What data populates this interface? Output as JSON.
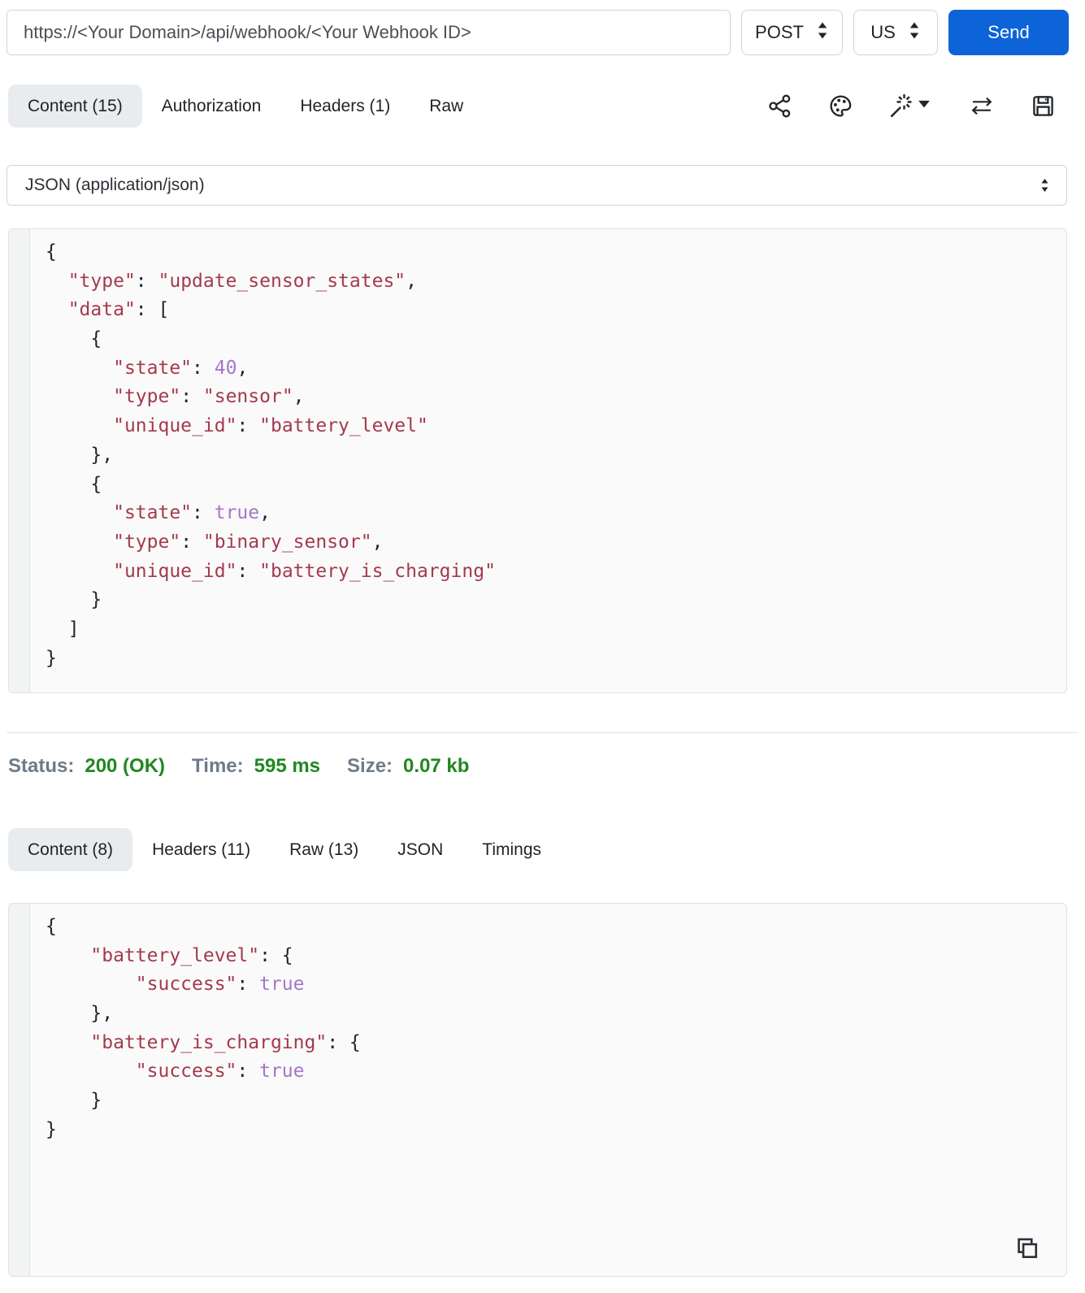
{
  "request_bar": {
    "url": "https://<Your Domain>/api/webhook/<Your Webhook ID>",
    "method": "POST",
    "region": "US",
    "send_label": "Send"
  },
  "request_tabs": {
    "items": [
      {
        "label": "Content (15)",
        "active": true
      },
      {
        "label": "Authorization",
        "active": false
      },
      {
        "label": "Headers (1)",
        "active": false
      },
      {
        "label": "Raw",
        "active": false
      }
    ]
  },
  "toolbar": {
    "icons": [
      "share-icon",
      "palette-icon",
      "magic-wand-icon",
      "caret-down-icon",
      "transfer-arrows-icon",
      "save-icon"
    ]
  },
  "content_type_select": {
    "selected": "JSON (application/json)"
  },
  "request_body": {
    "lines": [
      [
        {
          "t": "{",
          "c": "p"
        }
      ],
      [
        {
          "t": "  ",
          "c": "p"
        },
        {
          "t": "\"type\"",
          "c": "s"
        },
        {
          "t": ": ",
          "c": "p"
        },
        {
          "t": "\"update_sensor_states\"",
          "c": "s"
        },
        {
          "t": ",",
          "c": "p"
        }
      ],
      [
        {
          "t": "  ",
          "c": "p"
        },
        {
          "t": "\"data\"",
          "c": "s"
        },
        {
          "t": ": [",
          "c": "p"
        }
      ],
      [
        {
          "t": "    {",
          "c": "p"
        }
      ],
      [
        {
          "t": "      ",
          "c": "p"
        },
        {
          "t": "\"state\"",
          "c": "s"
        },
        {
          "t": ": ",
          "c": "p"
        },
        {
          "t": "40",
          "c": "n"
        },
        {
          "t": ",",
          "c": "p"
        }
      ],
      [
        {
          "t": "      ",
          "c": "p"
        },
        {
          "t": "\"type\"",
          "c": "s"
        },
        {
          "t": ": ",
          "c": "p"
        },
        {
          "t": "\"sensor\"",
          "c": "s"
        },
        {
          "t": ",",
          "c": "p"
        }
      ],
      [
        {
          "t": "      ",
          "c": "p"
        },
        {
          "t": "\"unique_id\"",
          "c": "s"
        },
        {
          "t": ": ",
          "c": "p"
        },
        {
          "t": "\"battery_level\"",
          "c": "s"
        }
      ],
      [
        {
          "t": "    },",
          "c": "p"
        }
      ],
      [
        {
          "t": "    {",
          "c": "p"
        }
      ],
      [
        {
          "t": "      ",
          "c": "p"
        },
        {
          "t": "\"state\"",
          "c": "s"
        },
        {
          "t": ": ",
          "c": "p"
        },
        {
          "t": "true",
          "c": "n"
        },
        {
          "t": ",",
          "c": "p"
        }
      ],
      [
        {
          "t": "      ",
          "c": "p"
        },
        {
          "t": "\"type\"",
          "c": "s"
        },
        {
          "t": ": ",
          "c": "p"
        },
        {
          "t": "\"binary_sensor\"",
          "c": "s"
        },
        {
          "t": ",",
          "c": "p"
        }
      ],
      [
        {
          "t": "      ",
          "c": "p"
        },
        {
          "t": "\"unique_id\"",
          "c": "s"
        },
        {
          "t": ": ",
          "c": "p"
        },
        {
          "t": "\"battery_is_charging\"",
          "c": "s"
        }
      ],
      [
        {
          "t": "    }",
          "c": "p"
        }
      ],
      [
        {
          "t": "  ]",
          "c": "p"
        }
      ],
      [
        {
          "t": "}",
          "c": "p"
        }
      ]
    ]
  },
  "response_summary": {
    "items": [
      {
        "label": "Status:",
        "value": "200 (OK)"
      },
      {
        "label": "Time:",
        "value": "595 ms"
      },
      {
        "label": "Size:",
        "value": "0.07 kb"
      }
    ]
  },
  "response_tabs": {
    "items": [
      {
        "label": "Content (8)",
        "active": true
      },
      {
        "label": "Headers (11)",
        "active": false
      },
      {
        "label": "Raw (13)",
        "active": false
      },
      {
        "label": "JSON",
        "active": false
      },
      {
        "label": "Timings",
        "active": false
      }
    ]
  },
  "response_body": {
    "lines": [
      [
        {
          "t": "{",
          "c": "p"
        }
      ],
      [
        {
          "t": "    ",
          "c": "p"
        },
        {
          "t": "\"battery_level\"",
          "c": "s"
        },
        {
          "t": ": {",
          "c": "p"
        }
      ],
      [
        {
          "t": "        ",
          "c": "p"
        },
        {
          "t": "\"success\"",
          "c": "s"
        },
        {
          "t": ": ",
          "c": "p"
        },
        {
          "t": "true",
          "c": "n"
        }
      ],
      [
        {
          "t": "    },",
          "c": "p"
        }
      ],
      [
        {
          "t": "    ",
          "c": "p"
        },
        {
          "t": "\"battery_is_charging\"",
          "c": "s"
        },
        {
          "t": ": {",
          "c": "p"
        }
      ],
      [
        {
          "t": "        ",
          "c": "p"
        },
        {
          "t": "\"success\"",
          "c": "s"
        },
        {
          "t": ": ",
          "c": "p"
        },
        {
          "t": "true",
          "c": "n"
        }
      ],
      [
        {
          "t": "    }",
          "c": "p"
        }
      ],
      [
        {
          "t": "}",
          "c": "p"
        }
      ]
    ]
  },
  "colors": {
    "accent_blue": "#0d64d8",
    "code_string": "#a43a4d",
    "code_atom": "#a577c9",
    "code_punct": "#1f2430",
    "status_value_green": "#218721",
    "status_label_gray": "#6e7b8a",
    "active_tab_bg": "#e9ecef"
  }
}
